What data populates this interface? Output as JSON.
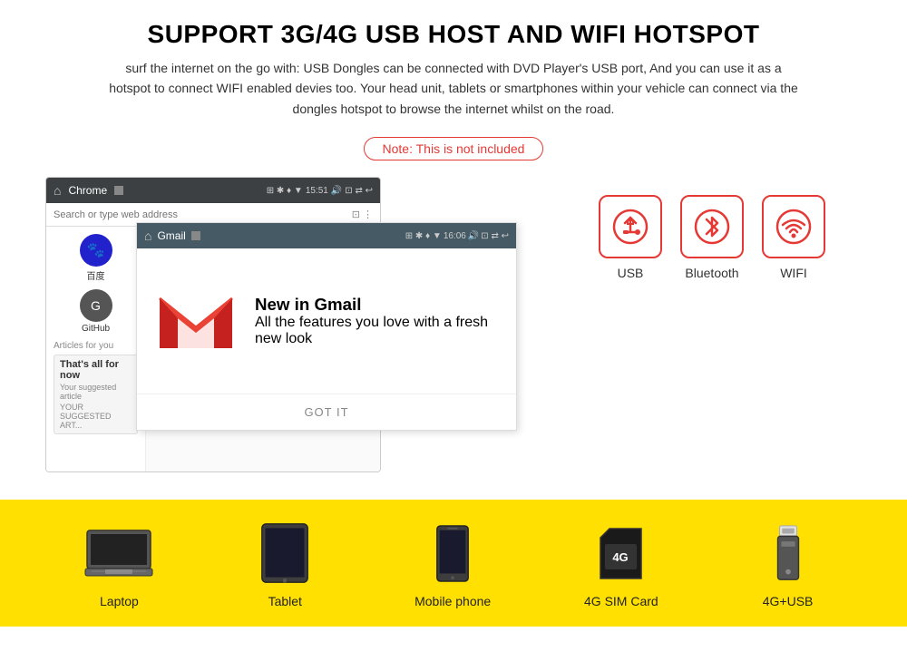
{
  "header": {
    "main_title": "SUPPORT 3G/4G USB HOST AND WIFI HOTSPOT",
    "subtitle": "surf the internet on the go with: USB Dongles can be connected with DVD Player's USB port, And you can use it as a hotspot to connect WIFI enabled devies too. Your head unit, tablets or smartphones within your vehicle can connect via the dongles hotspot to browse the internet whilst on the road.",
    "note": "Note: This is not included"
  },
  "browser": {
    "app_name": "Chrome",
    "time": "15:51",
    "address_placeholder": "Search or type web address"
  },
  "gmail": {
    "app_name": "Gmail",
    "time": "16:06",
    "title": "New in Gmail",
    "body": "All the features you love with a fresh new look",
    "button": "GOT IT"
  },
  "apps": {
    "baidu": {
      "label": "百度",
      "initial": "🐾"
    },
    "github": {
      "label": "GitHub",
      "initial": "G"
    },
    "articles": "Articles for you",
    "card_title": "That's all for now",
    "card_body": "Your suggested article"
  },
  "connectivity_icons": [
    {
      "id": "usb",
      "label": "USB",
      "icon": "⚡"
    },
    {
      "id": "bluetooth",
      "label": "Bluetooth",
      "icon": "✳"
    },
    {
      "id": "wifi",
      "label": "WIFI",
      "icon": "📶"
    }
  ],
  "devices": [
    {
      "id": "laptop",
      "label": "Laptop"
    },
    {
      "id": "tablet",
      "label": "Tablet"
    },
    {
      "id": "phone",
      "label": "Mobile phone"
    },
    {
      "id": "sim",
      "label": "4G SIM Card"
    },
    {
      "id": "usb-drive",
      "label": "4G+USB"
    }
  ]
}
